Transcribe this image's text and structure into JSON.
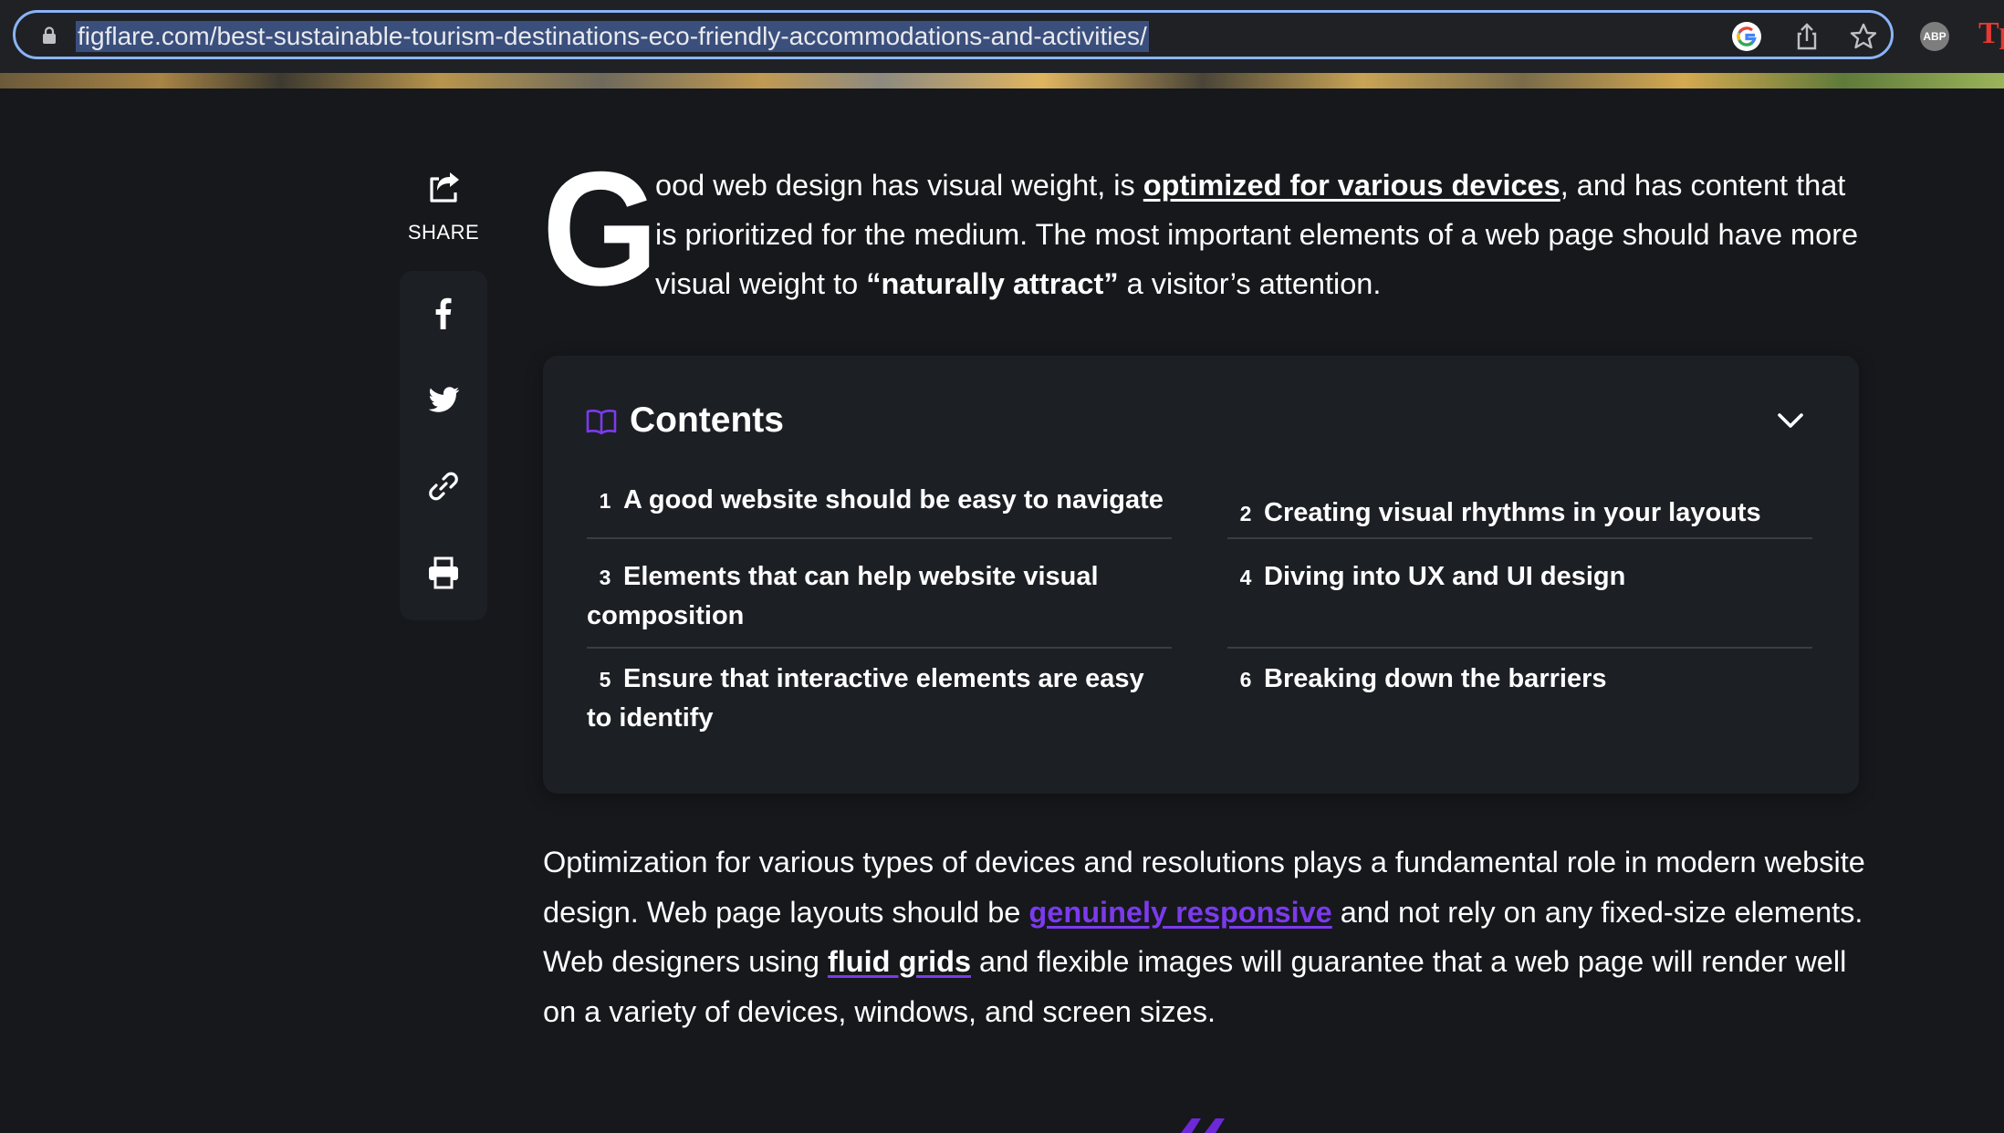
{
  "browser": {
    "url": "figflare.com/best-sustainable-tourism-destinations-eco-friendly-accommodations-and-activities/",
    "icons": [
      "lock-icon",
      "google-icon",
      "share-page-icon",
      "bookmark-star-icon"
    ],
    "extensions": {
      "abp_label": "ABP",
      "tp_label": "Tp"
    }
  },
  "share": {
    "label": "SHARE",
    "icons": [
      "share-icon",
      "facebook-icon",
      "twitter-icon",
      "link-icon",
      "print-icon"
    ]
  },
  "lead": {
    "dropcap": "G",
    "text_1": "ood web design has visual weight, is ",
    "link_1": "optimized for various devices",
    "text_2": ", and has content that is prioritized for the medium. The most important elements of a web page should have more visual weight to ",
    "bold_1": "“naturally attract”",
    "text_3": " a visitor’s attention."
  },
  "toc": {
    "title": "Contents",
    "items": [
      {
        "num": "1",
        "label": "A good website should be easy to navigate"
      },
      {
        "num": "2",
        "label": "Creating visual rhythms in your layouts"
      },
      {
        "num": "3",
        "label": "Elements that can help website visual composition"
      },
      {
        "num": "4",
        "label": "Diving into UX and UI design"
      },
      {
        "num": "5",
        "label": "Ensure that interactive elements are easy to identify"
      },
      {
        "num": "6",
        "label": "Breaking down the barriers"
      }
    ]
  },
  "body": {
    "text_1": "Optimization for various types of devices and resolutions plays a fundamental role in modern website design. Web page layouts should be ",
    "link_1": "genuinely responsive",
    "text_2": " and not rely on any fixed-size elements. Web designers using ",
    "link_2": "fluid grids",
    "text_3": " and flexible images will guarantee that a web page will render well on a variety of devices, windows, and screen sizes."
  },
  "colors": {
    "background": "#16181c",
    "panel": "#1c1f24",
    "accent": "#7c3aed",
    "address_focus": "#8ab4f8"
  }
}
